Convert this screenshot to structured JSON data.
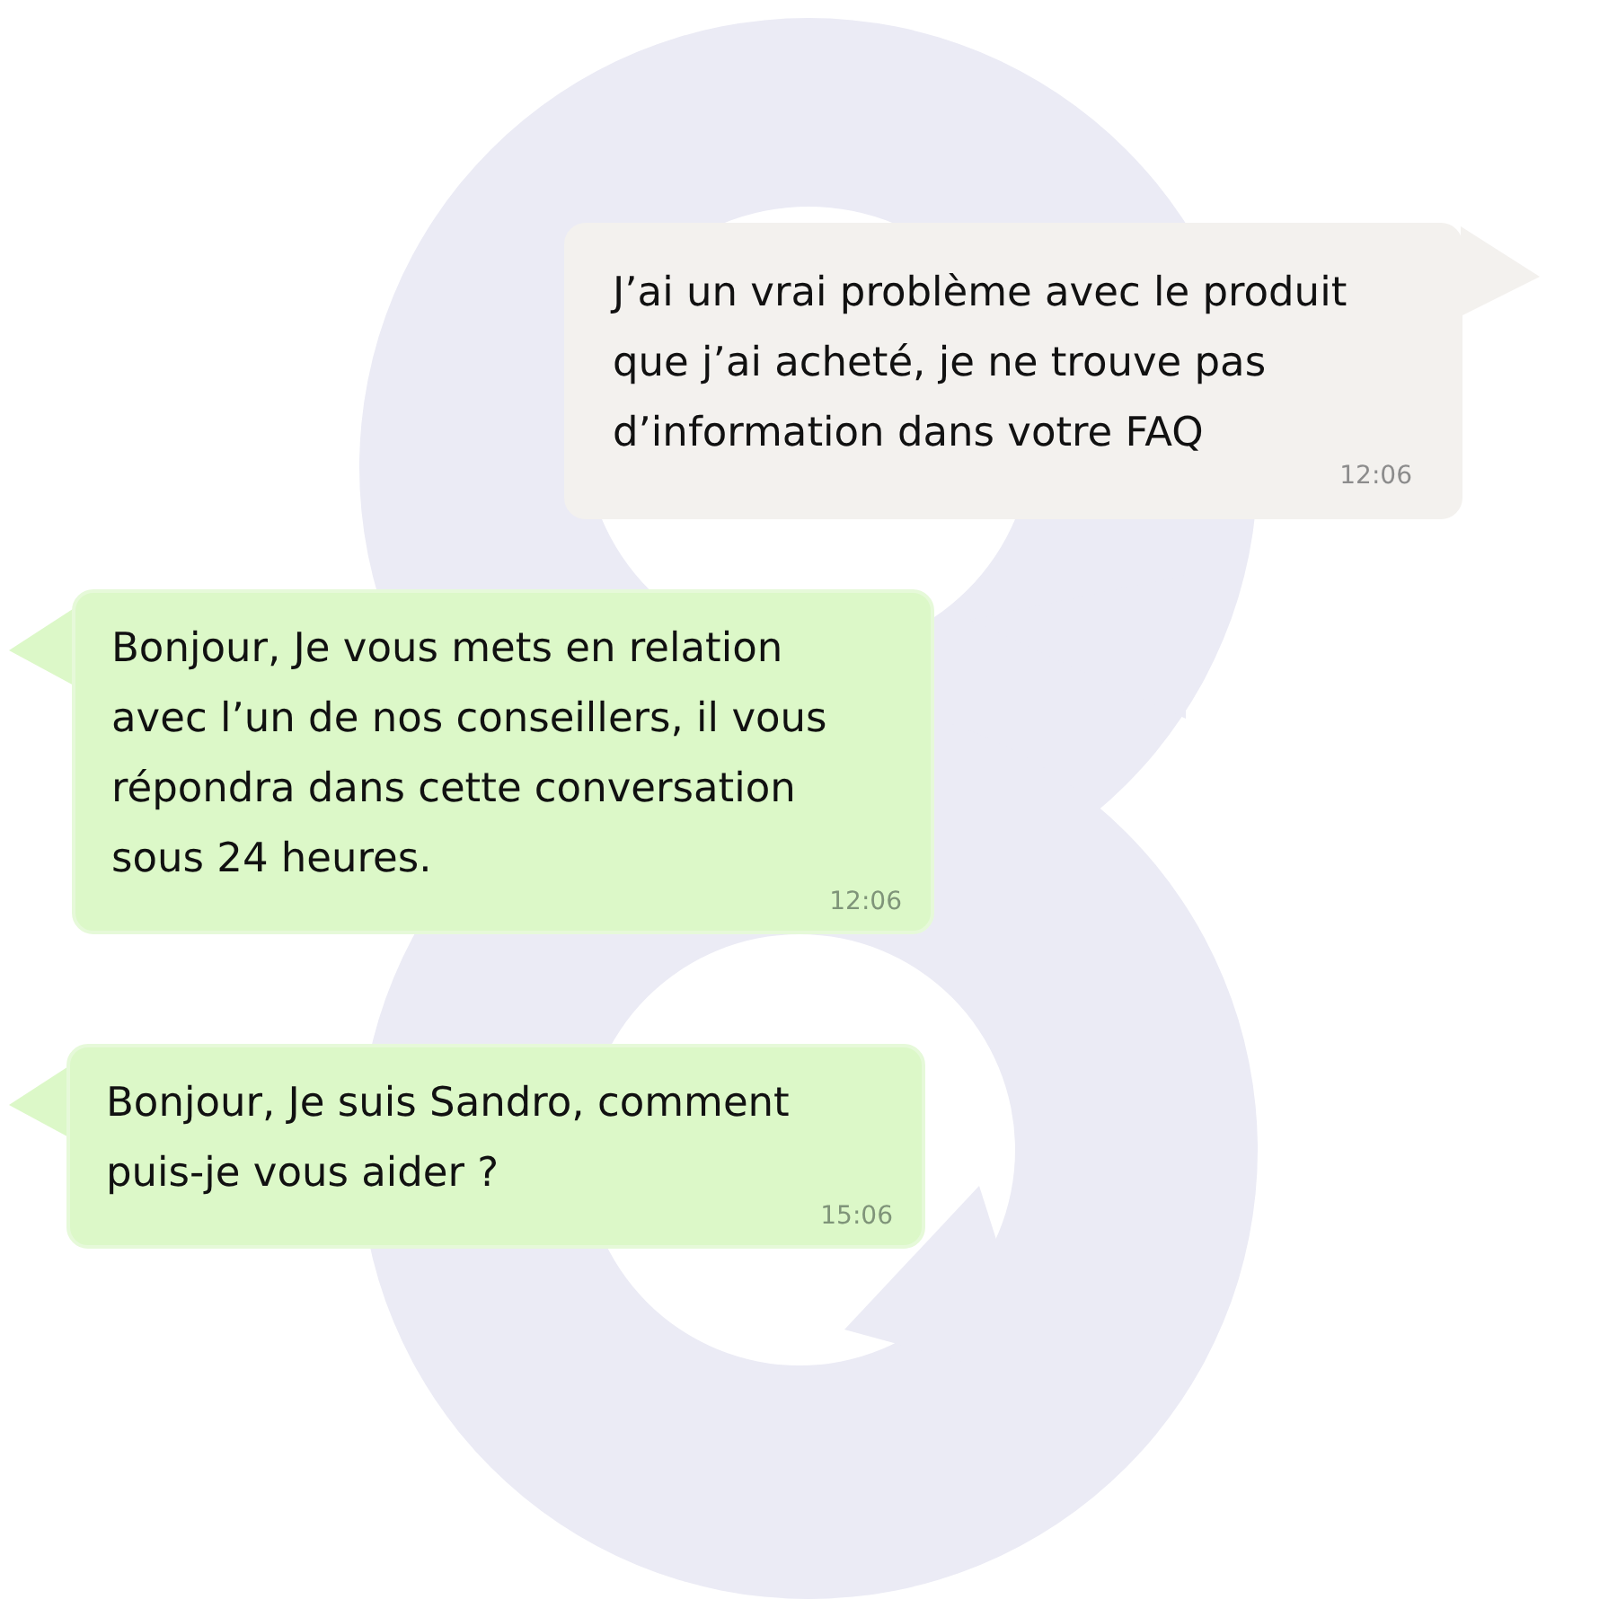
{
  "messages": [
    {
      "kind": "outgoing",
      "text": "J’ai un vrai problème avec le produit que j’ai acheté, je ne trouve pas d’information dans votre FAQ",
      "time": "12:06"
    },
    {
      "kind": "incoming",
      "text": "Bonjour, Je vous mets en relation avec l’un de nos conseillers, il vous répondra dans cette conversation sous 24 heures.",
      "time": "12:06"
    },
    {
      "kind": "incoming",
      "text": "Bonjour, Je suis Sandro, comment puis-je vous aider ?",
      "time": "15:06"
    }
  ]
}
